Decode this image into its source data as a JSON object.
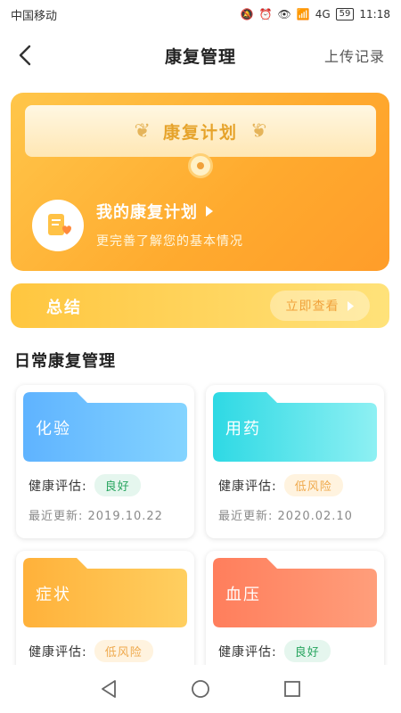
{
  "status_bar": {
    "carrier": "中国移动",
    "network": "4G",
    "battery": "59",
    "time": "11:18"
  },
  "nav": {
    "title": "康复管理",
    "upload_label": "上传记录"
  },
  "plan_card": {
    "banner_title": "康复计划",
    "my_plan_label": "我的康复计划",
    "subtitle": "更完善了解您的基本情况"
  },
  "summary": {
    "title": "总结",
    "view_label": "立即查看"
  },
  "section": {
    "title": "日常康复管理"
  },
  "cards": [
    {
      "title": "化验",
      "assess_label": "健康评估:",
      "status": "良好",
      "status_type": "good",
      "updated": "最近更新: 2019.10.22",
      "color_from": "#5fb3ff",
      "color_to": "#7fd0ff"
    },
    {
      "title": "用药",
      "assess_label": "健康评估:",
      "status": "低风险",
      "status_type": "risk",
      "updated": "最近更新: 2020.02.10",
      "color_from": "#2ed9e4",
      "color_to": "#8bf0f2"
    },
    {
      "title": "症状",
      "assess_label": "健康评估:",
      "status": "低风险",
      "status_type": "risk",
      "color_from": "#ffb13a",
      "color_to": "#ffce5e"
    },
    {
      "title": "血压",
      "assess_label": "健康评估:",
      "status": "良好",
      "status_type": "good",
      "color_from": "#ff7e5c",
      "color_to": "#ff9c78"
    }
  ]
}
